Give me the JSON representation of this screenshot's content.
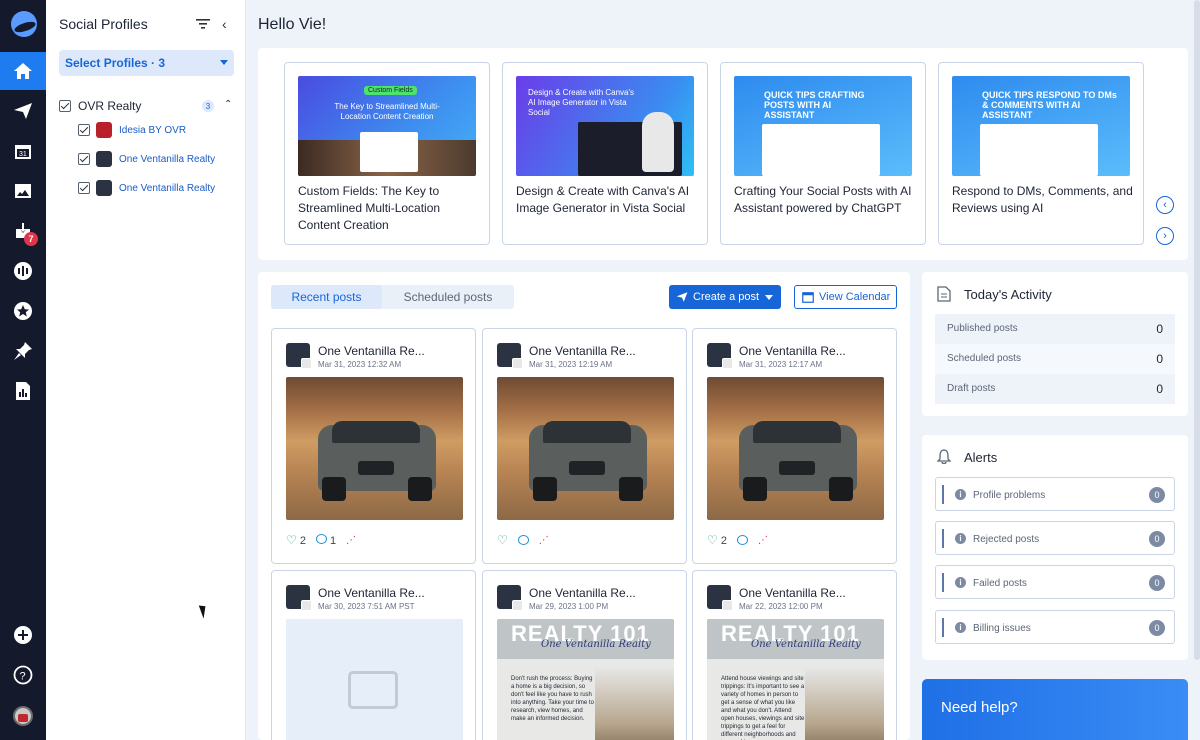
{
  "nav": {
    "badge_count": "7",
    "items": [
      "home-icon",
      "send-icon",
      "calendar-icon",
      "image-icon",
      "inbox-icon",
      "listening-icon",
      "reviews-icon",
      "pin-icon",
      "reports-icon"
    ],
    "calendar_day": "31"
  },
  "profiles": {
    "title": "Social Profiles",
    "select_label": "Select Profiles · 3",
    "group": {
      "name": "OVR Realty",
      "count": "3"
    },
    "items": [
      {
        "name": "Idesia BY OVR"
      },
      {
        "name": "One Ventanilla Realty"
      },
      {
        "name": "One Ventanilla Realty"
      }
    ]
  },
  "greeting": "Hello Vie!",
  "carousel": [
    {
      "title": "Custom Fields: The Key to Streamlined Multi-Location Content Creation",
      "thumb_tag": "Custom Fields",
      "thumb_text": "The Key to Streamlined Multi-Location Content Creation"
    },
    {
      "title": "Design & Create with Canva's AI Image Generator in Vista Social",
      "thumb_text": "Design & Create with Canva's AI Image Generator in Vista Social"
    },
    {
      "title": "Crafting Your Social Posts with AI Assistant powered by ChatGPT",
      "thumb_text": "QUICK TIPS CRAFTING POSTS WITH AI ASSISTANT"
    },
    {
      "title": "Respond to DMs, Comments, and Reviews using AI",
      "thumb_text": "QUICK TIPS RESPOND TO DMs & COMMENTS WITH AI ASSISTANT"
    }
  ],
  "posts_panel": {
    "tab_recent": "Recent posts",
    "tab_scheduled": "Scheduled posts",
    "create_label": "Create a post",
    "calendar_label": "View Calendar",
    "posts": [
      {
        "name": "One Ventanilla Re...",
        "date": "Mar 31, 2023 12:32 AM",
        "likes": "2",
        "comments": "1"
      },
      {
        "name": "One Ventanilla Re...",
        "date": "Mar 31, 2023 12:19 AM",
        "likes": "",
        "comments": ""
      },
      {
        "name": "One Ventanilla Re...",
        "date": "Mar 31, 2023 12:17 AM",
        "likes": "2",
        "comments": ""
      },
      {
        "name": "One Ventanilla Re...",
        "date": "Mar 30, 2023 7:51 AM PST"
      },
      {
        "name": "One Ventanilla Re...",
        "date": "Mar 29, 2023 1:00 PM",
        "img_title": "REALTY 101",
        "img_script": "One Ventanilla Realty",
        "img_text": "Don't rush the process: Buying a home is a big decision, so don't feel like you have to rush into anything. Take your time to research, view homes, and make an informed decision."
      },
      {
        "name": "One Ventanilla Re...",
        "date": "Mar 22, 2023 12:00 PM",
        "img_title": "REALTY 101",
        "img_script": "One Ventanilla Realty",
        "img_text": "Attend house viewings and site trippings: It's important to see a variety of homes in person to get a sense of what you like and what you don't. Attend open houses, viewings and site trippings to get a feel for different neighborhoods and types of homes."
      }
    ]
  },
  "activity": {
    "title": "Today's Activity",
    "rows": [
      {
        "label": "Published posts",
        "value": "0"
      },
      {
        "label": "Scheduled posts",
        "value": "0"
      },
      {
        "label": "Draft posts",
        "value": "0"
      }
    ]
  },
  "alerts": {
    "title": "Alerts",
    "rows": [
      {
        "label": "Profile problems",
        "value": "0"
      },
      {
        "label": "Rejected posts",
        "value": "0"
      },
      {
        "label": "Failed posts",
        "value": "0"
      },
      {
        "label": "Billing issues",
        "value": "0"
      }
    ]
  },
  "help": {
    "label": "Need help?"
  },
  "colors": {
    "accent": "#1666d8",
    "nav_bg": "#141a2b",
    "nav_active": "#1e7bf0",
    "page_bg": "#eef3fa"
  }
}
